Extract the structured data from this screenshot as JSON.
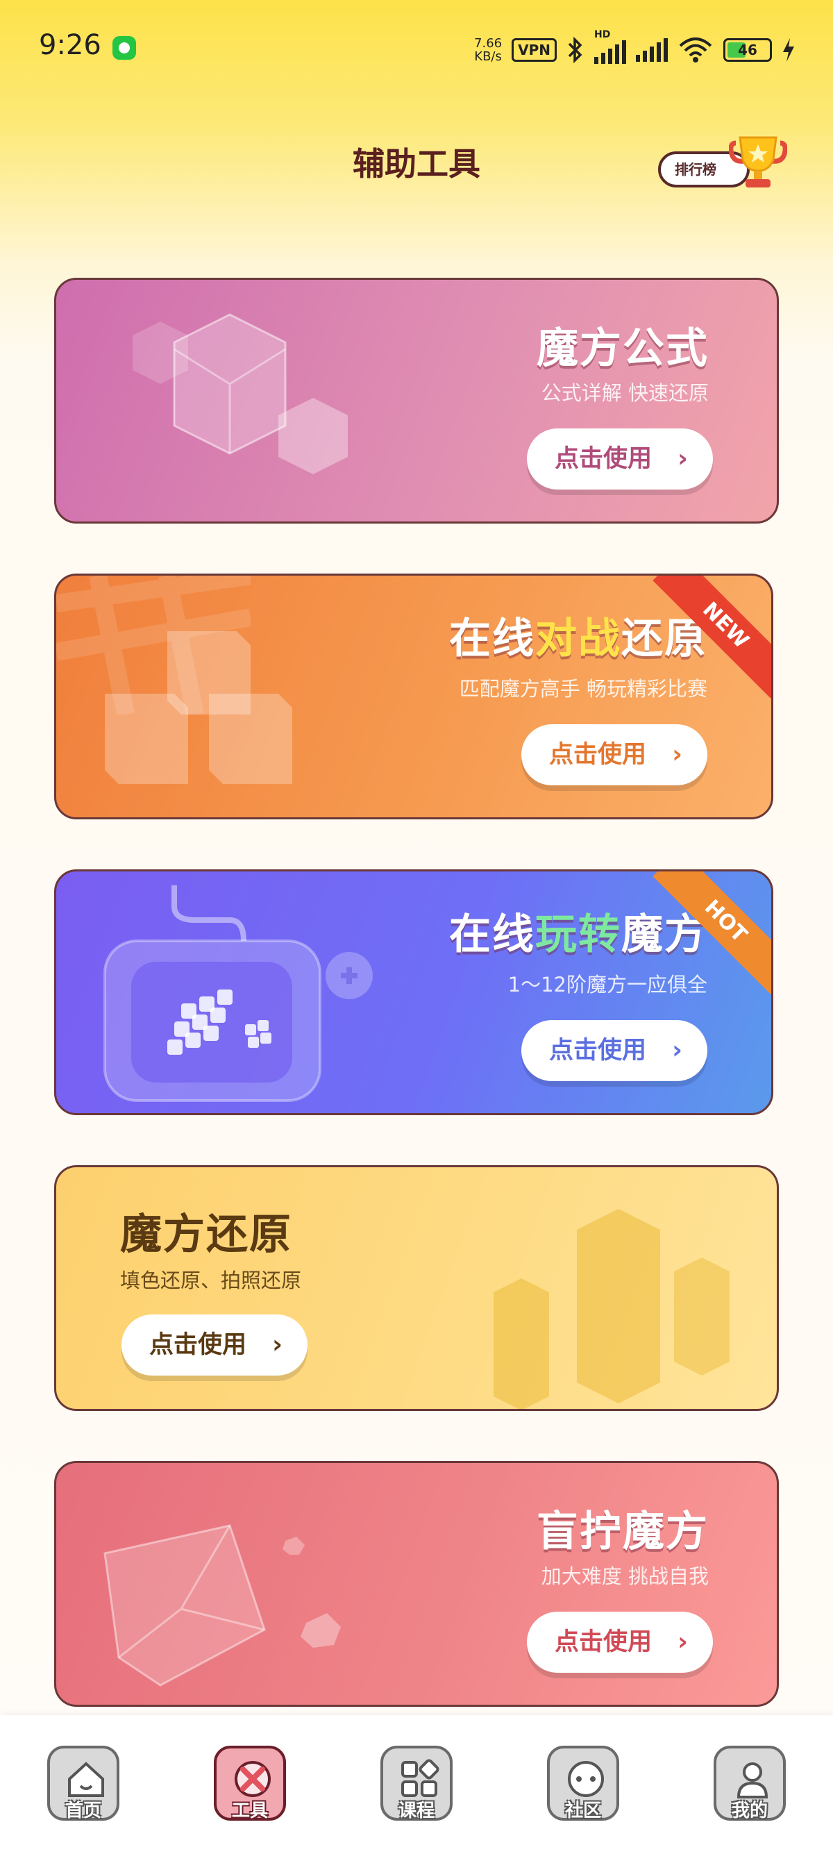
{
  "status_bar": {
    "time": "9:26",
    "net_speed_value": "7.66",
    "net_speed_unit": "KB/s",
    "vpn": "VPN",
    "hd": "HD",
    "battery": "46"
  },
  "header": {
    "title": "辅助工具",
    "rank_label": "排行榜"
  },
  "cards": [
    {
      "title": "魔方公式",
      "subtitle": "公式详解  快速还原",
      "button": "点击使用"
    },
    {
      "title_a": "在线",
      "title_b": "对战",
      "title_c": "还原",
      "subtitle": "匹配魔方高手 畅玩精彩比赛",
      "button": "点击使用",
      "badge": "NEW"
    },
    {
      "title_a": "在线",
      "title_b": "玩转",
      "title_c": "魔方",
      "subtitle": "1～12阶魔方一应俱全",
      "button": "点击使用",
      "badge": "HOT"
    },
    {
      "title": "魔方还原",
      "subtitle": "填色还原、拍照还原",
      "button": "点击使用"
    },
    {
      "title": "盲拧魔方",
      "subtitle": "加大难度 挑战自我",
      "button": "点击使用"
    }
  ],
  "chevron": "›",
  "bottom_nav": [
    {
      "label": "首页",
      "icon": "home-icon"
    },
    {
      "label": "工具",
      "icon": "tools-icon",
      "active": true
    },
    {
      "label": "课程",
      "icon": "course-icon"
    },
    {
      "label": "社区",
      "icon": "community-icon"
    },
    {
      "label": "我的",
      "icon": "profile-icon"
    }
  ],
  "colors": {
    "card1": "#d97fb0",
    "card2": "#f39a4e",
    "card3": "#7b6cf6",
    "card4": "#fdd27a",
    "card5": "#f08a8a",
    "accent_yellow": "#ffd84a",
    "accent_green": "#7ee8a0"
  }
}
